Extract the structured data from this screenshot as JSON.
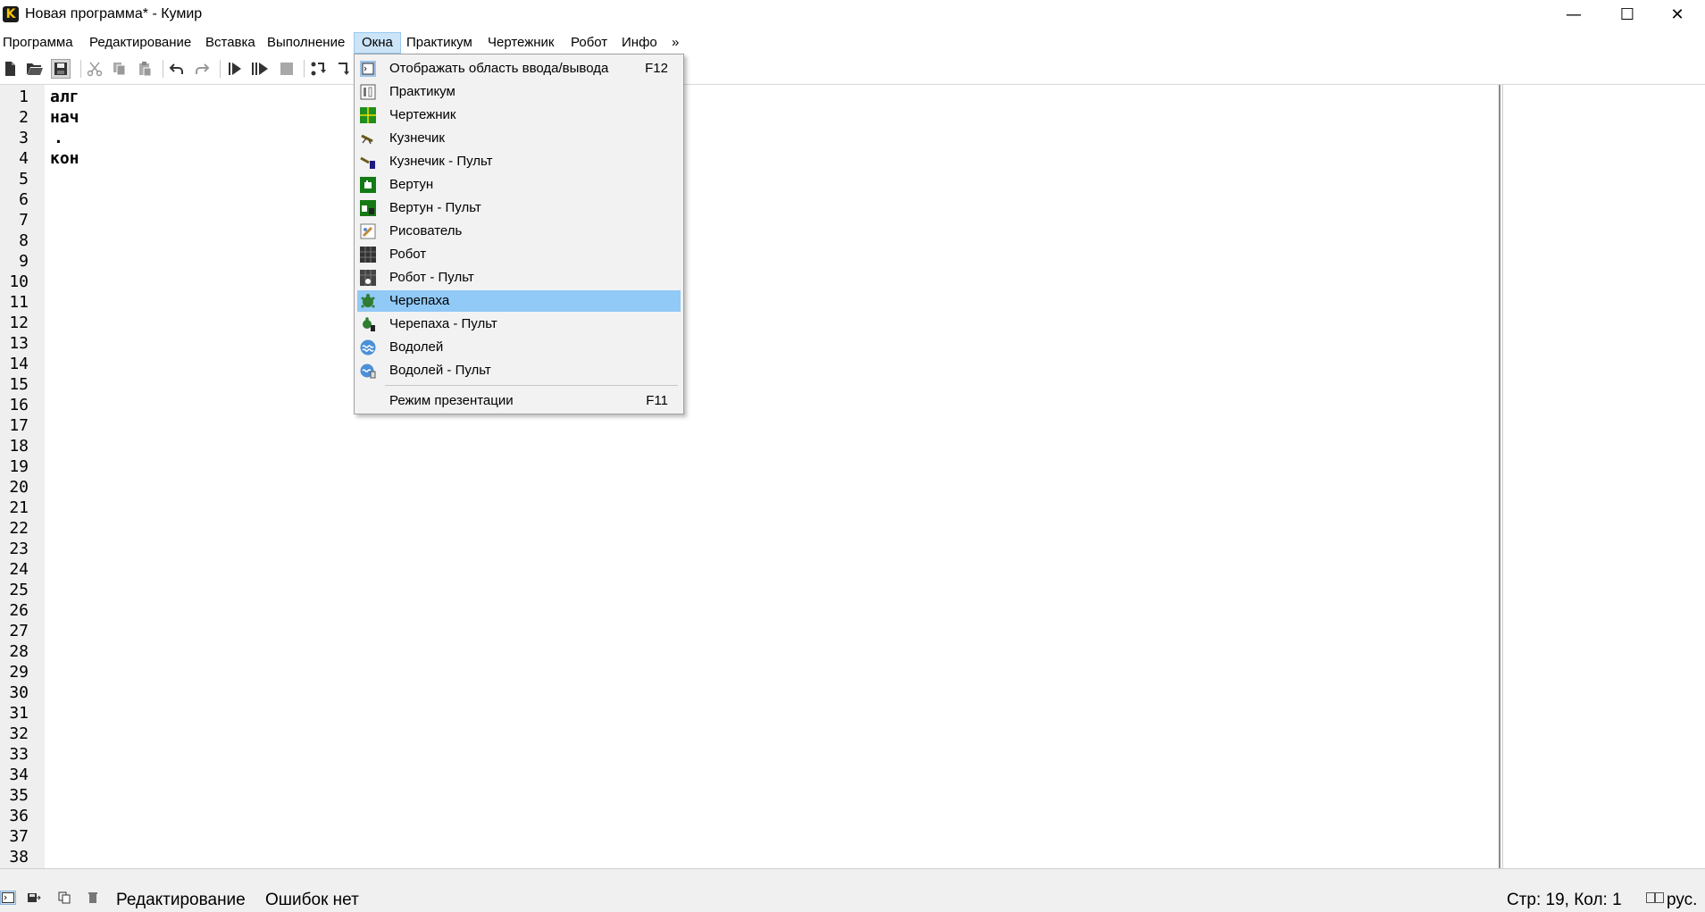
{
  "window": {
    "title": "Новая программа* - Кумир",
    "logo_letter": "K",
    "minimize_glyph": "—",
    "maximize_glyph": "☐",
    "close_glyph": "✕"
  },
  "menu": {
    "items": [
      "Программа",
      "Редактирование",
      "Вставка",
      "Выполнение",
      "Окна",
      "Практикум",
      "Чертежник",
      "Робот",
      "Инфо",
      "»"
    ],
    "active": "Окна"
  },
  "toolbar": {
    "icons": [
      "new-file-icon",
      "open-folder-icon",
      "save-icon",
      "cut-icon",
      "copy-icon",
      "paste-icon",
      "undo-icon",
      "redo-icon",
      "run-icon",
      "run-step-icon",
      "stop-icon",
      "step-in-icon",
      "step-out-icon"
    ]
  },
  "editor": {
    "line_numbers": [
      "1",
      "2",
      "3",
      "4",
      "5",
      "6",
      "7",
      "8",
      "9",
      "10",
      "11",
      "12",
      "13",
      "14",
      "15",
      "16",
      "17",
      "18",
      "19",
      "20",
      "21",
      "22",
      "23",
      "24",
      "25",
      "26",
      "27",
      "28",
      "29",
      "30",
      "31",
      "32",
      "33",
      "34",
      "35",
      "36",
      "37",
      "38"
    ],
    "lines": [
      "алг",
      "нач",
      ".",
      "кон"
    ]
  },
  "windows_menu": {
    "items": [
      {
        "label": "Отображать область ввода/вывода",
        "shortcut": "F12",
        "icon": "io-panel-icon"
      },
      {
        "label": "Практикум",
        "shortcut": "",
        "icon": "practicum-icon"
      },
      {
        "label": "Чертежник",
        "shortcut": "",
        "icon": "draftsman-icon"
      },
      {
        "label": "Кузнечик",
        "shortcut": "",
        "icon": "grasshopper-icon"
      },
      {
        "label": "Кузнечик - Пульт",
        "shortcut": "",
        "icon": "grasshopper-remote-icon"
      },
      {
        "label": "Вертун",
        "shortcut": "",
        "icon": "vertun-icon"
      },
      {
        "label": "Вертун - Пульт",
        "shortcut": "",
        "icon": "vertun-remote-icon"
      },
      {
        "label": "Рисователь",
        "shortcut": "",
        "icon": "painter-icon"
      },
      {
        "label": "Робот",
        "shortcut": "",
        "icon": "robot-icon"
      },
      {
        "label": "Робот - Пульт",
        "shortcut": "",
        "icon": "robot-remote-icon"
      },
      {
        "label": "Черепаха",
        "shortcut": "",
        "icon": "turtle-icon"
      },
      {
        "label": "Черепаха - Пульт",
        "shortcut": "",
        "icon": "turtle-remote-icon"
      },
      {
        "label": "Водолей",
        "shortcut": "",
        "icon": "aquarius-icon"
      },
      {
        "label": "Водолей - Пульт",
        "shortcut": "",
        "icon": "aquarius-remote-icon"
      }
    ],
    "highlighted": "Черепаха",
    "presentation": {
      "label": "Режим презентации",
      "shortcut": "F11"
    }
  },
  "status": {
    "mode": "Редактирование",
    "errors": "Ошибок нет",
    "position": "Стр: 19, Кол: 1",
    "language": "рус."
  },
  "colors": {
    "menu_active_bg": "#cce4f7",
    "dropdown_bg": "#f2f2f2",
    "dropdown_highlight": "#91c9f7",
    "gutter_bg": "#efefef",
    "status_bg": "#f0f0f0"
  }
}
